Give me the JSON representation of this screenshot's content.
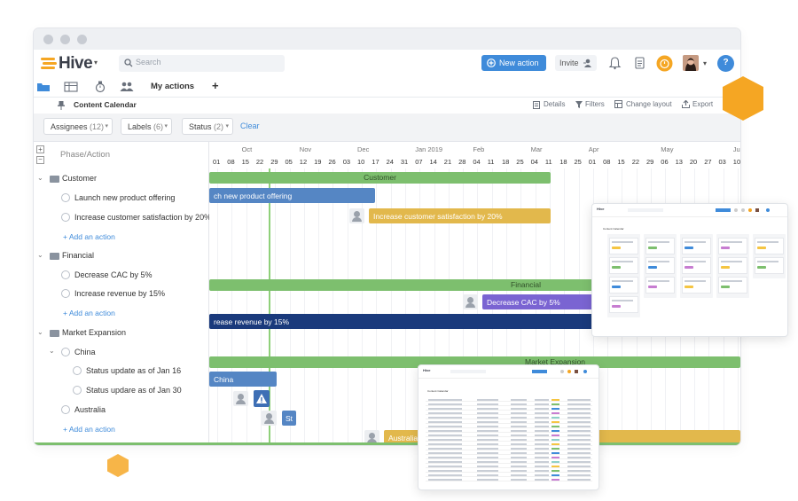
{
  "app": {
    "name": "Hive",
    "search_placeholder": "Search",
    "new_action_label": "New action",
    "invite_label": "Invite",
    "help_label": "?"
  },
  "toolbar": {
    "tab_label": "My actions",
    "add_label": "+"
  },
  "breadcrumb": {
    "project": "Content Calendar",
    "actions": [
      "Details",
      "Filters",
      "Change layout",
      "Export"
    ]
  },
  "filters": {
    "items": [
      {
        "label": "Assignees",
        "count": "(12)"
      },
      {
        "label": "Labels",
        "count": "(6)"
      },
      {
        "label": "Status",
        "count": "(2)"
      }
    ],
    "clear_label": "Clear"
  },
  "left_panel": {
    "header": "Phase/Action",
    "groups": [
      {
        "name": "Customer",
        "items": [
          "Launch new product offering",
          "Increase customer satisfaction by 20%"
        ],
        "add": "+ Add an action"
      },
      {
        "name": "Financial",
        "items": [
          "Decrease CAC by 5%",
          "Increase revenue by 15%"
        ],
        "add": "+ Add an action"
      },
      {
        "name": "Market Expansion",
        "sub": "China",
        "sub_items": [
          "Status update as of Jan 16",
          "Status updare as of Jan 30"
        ],
        "items": [
          "Australia"
        ],
        "add": "+ Add an action"
      }
    ]
  },
  "timeline": {
    "months": [
      "Oct",
      "Nov",
      "Dec",
      "Jan 2019",
      "Feb",
      "Mar",
      "Apr",
      "May",
      "Ju"
    ],
    "days": [
      "01",
      "08",
      "15",
      "22",
      "29",
      "05",
      "12",
      "19",
      "26",
      "03",
      "10",
      "17",
      "24",
      "31",
      "07",
      "14",
      "21",
      "28",
      "04",
      "11",
      "18",
      "25",
      "04",
      "11",
      "18",
      "25",
      "01",
      "08",
      "15",
      "22",
      "29",
      "06",
      "13",
      "20",
      "27",
      "03",
      "10"
    ],
    "bars": {
      "customer": "Customer",
      "launch": "ch new product offering",
      "satisfaction": "Increase customer satisfaction by 20%",
      "financial": "Financial",
      "cac": "Decrease CAC by 5%",
      "revenue": "rease revenue by 15%",
      "market": "Market Expansion",
      "china": "China",
      "status_short": "St",
      "australia": "Australia"
    }
  },
  "colors": {
    "accent": "#3f8bda",
    "group_bar": "#7dbf6e",
    "blue_bar": "#5586c4",
    "gold_bar": "#e2b84c",
    "purple_bar": "#7a64d2",
    "navy_bar": "#1a3a7c",
    "hex_orange": "#f5a623"
  },
  "thumbnails": {
    "kanban_title": "Content Calendar",
    "table_title": "Content Calendar"
  }
}
